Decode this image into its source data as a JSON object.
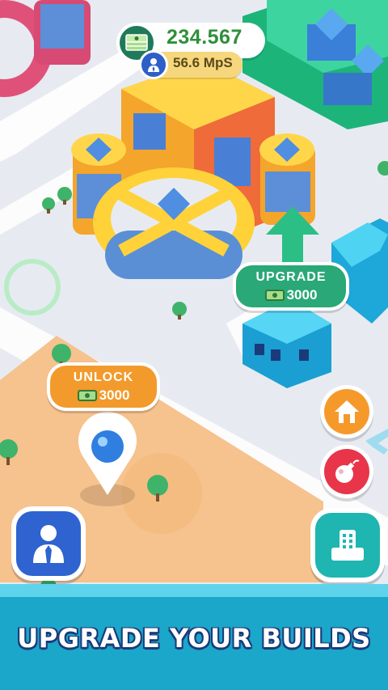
{
  "hud": {
    "money_value": "234.567",
    "mps_value": "56.6 MpS",
    "money_icon": "cash-stack-icon",
    "mps_icon": "manager-icon"
  },
  "upgrade_tag": {
    "title": "UPGRADE",
    "cost": "3000",
    "icon": "cash-icon"
  },
  "unlock_tag": {
    "title": "UNLOCK",
    "cost": "3000",
    "icon": "cash-icon"
  },
  "buttons": {
    "home": "home-icon",
    "bomb": "bomb-icon",
    "buildings": "building-icon",
    "manager": "manager-icon"
  },
  "banner": {
    "caption": "UPGRADE YOUR BUILDS"
  },
  "colors": {
    "money_text": "#2f8f3a",
    "mps_pill": "#f6d77d",
    "upgrade_green": "#2aa877",
    "unlock_orange": "#f29a2b",
    "home_orange": "#f59a2a",
    "bomb_red": "#e8354a",
    "buildings_teal": "#1fb5b0",
    "manager_blue": "#2e63d0",
    "banner": "#1aa7c9"
  }
}
